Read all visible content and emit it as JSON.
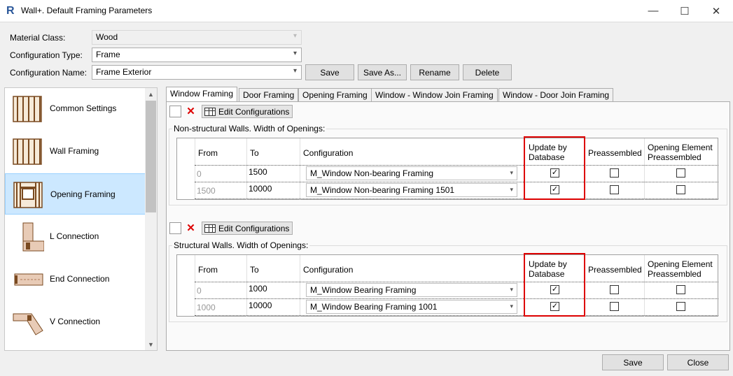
{
  "window": {
    "app_icon": "R",
    "title": "Wall+. Default Framing Parameters",
    "minimize": "—",
    "maximize": "☐",
    "close": "✕"
  },
  "form": {
    "material_class_label": "Material Class:",
    "material_class_value": "Wood",
    "configuration_type_label": "Configuration Type:",
    "configuration_type_value": "Frame",
    "configuration_name_label": "Configuration Name:",
    "configuration_name_value": "Frame Exterior",
    "dropdown_arrow": "▾",
    "save": "Save",
    "save_as": "Save As...",
    "rename": "Rename",
    "delete": "Delete"
  },
  "nav": {
    "items": [
      {
        "label": "Common Settings",
        "icon": "studs-icon",
        "selected": false
      },
      {
        "label": "Wall Framing",
        "icon": "studs-icon",
        "selected": false
      },
      {
        "label": "Opening Framing",
        "icon": "window-frame-icon",
        "selected": true
      },
      {
        "label": "L Connection",
        "icon": "l-connection-icon",
        "selected": false
      },
      {
        "label": "End Connection",
        "icon": "end-connection-icon",
        "selected": false
      },
      {
        "label": "V Connection",
        "icon": "v-connection-icon",
        "selected": false
      }
    ],
    "scroll_up": "▲",
    "scroll_down": "▼"
  },
  "tabs": [
    "Window Framing",
    "Door Framing",
    "Opening Framing",
    "Window - Window Join Framing",
    "Window - Door Join Framing"
  ],
  "active_tab": "Window Framing",
  "toolbar": {
    "edit_configurations": "Edit Configurations"
  },
  "columns": {
    "from": "From",
    "to": "To",
    "configuration": "Configuration",
    "update_by_database": "Update by Database",
    "preassembled": "Preassembled",
    "opening_element_preassembled": "Opening Element Preassembled"
  },
  "checkmark": "✓",
  "nonstructural": {
    "title": "Non-structural Walls. Width of Openings:",
    "rows": [
      {
        "from": "0",
        "to": "1500",
        "configuration": "M_Window Non-bearing Framing",
        "update_by_database": true,
        "preassembled": false,
        "opening_element_preassembled": false
      },
      {
        "from": "1500",
        "to": "10000",
        "configuration": "M_Window Non-bearing Framing 1501",
        "update_by_database": true,
        "preassembled": false,
        "opening_element_preassembled": false
      }
    ]
  },
  "structural": {
    "title": "Structural Walls. Width of Openings:",
    "rows": [
      {
        "from": "0",
        "to": "1000",
        "configuration": "M_Window Bearing Framing",
        "update_by_database": true,
        "preassembled": false,
        "opening_element_preassembled": false
      },
      {
        "from": "1000",
        "to": "10000",
        "configuration": "M_Window Bearing Framing 1001",
        "update_by_database": true,
        "preassembled": false,
        "opening_element_preassembled": false
      }
    ]
  },
  "footer": {
    "save": "Save",
    "close": "Close"
  },
  "colors": {
    "highlight_box": "#dd0000",
    "selected_nav": "#cce8ff",
    "app_icon": "#2b579a"
  }
}
